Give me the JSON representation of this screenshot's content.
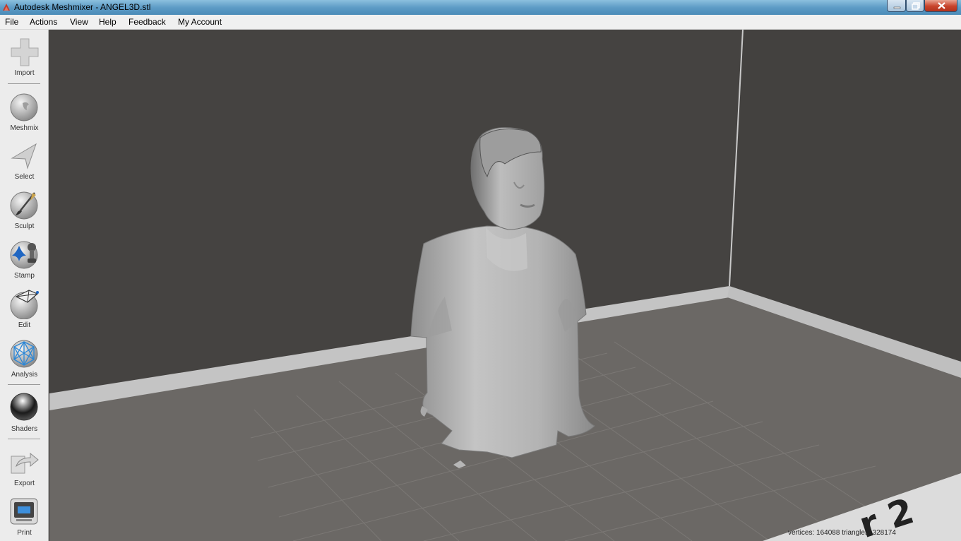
{
  "window": {
    "title": "Autodesk Meshmixer - ANGEL3D.stl",
    "controls": [
      "minimize",
      "restore",
      "close"
    ]
  },
  "menu": [
    "File",
    "Actions",
    "View",
    "Help",
    "Feedback",
    "My Account"
  ],
  "toolbar": {
    "import": "Import",
    "meshmix": "Meshmix",
    "select": "Select",
    "sculpt": "Sculpt",
    "stamp": "Stamp",
    "edit": "Edit",
    "analysis": "Analysis",
    "shaders": "Shaders",
    "export": "Export",
    "print": "Print"
  },
  "viewport": {
    "printer_label": "r 2",
    "status": "vertices: 164088 triangles: 328174"
  },
  "colors": {
    "background": "#454341",
    "floor": "#6b6865",
    "wall_rail": "#c9c9c9",
    "mesh": "#b8b8b8"
  }
}
